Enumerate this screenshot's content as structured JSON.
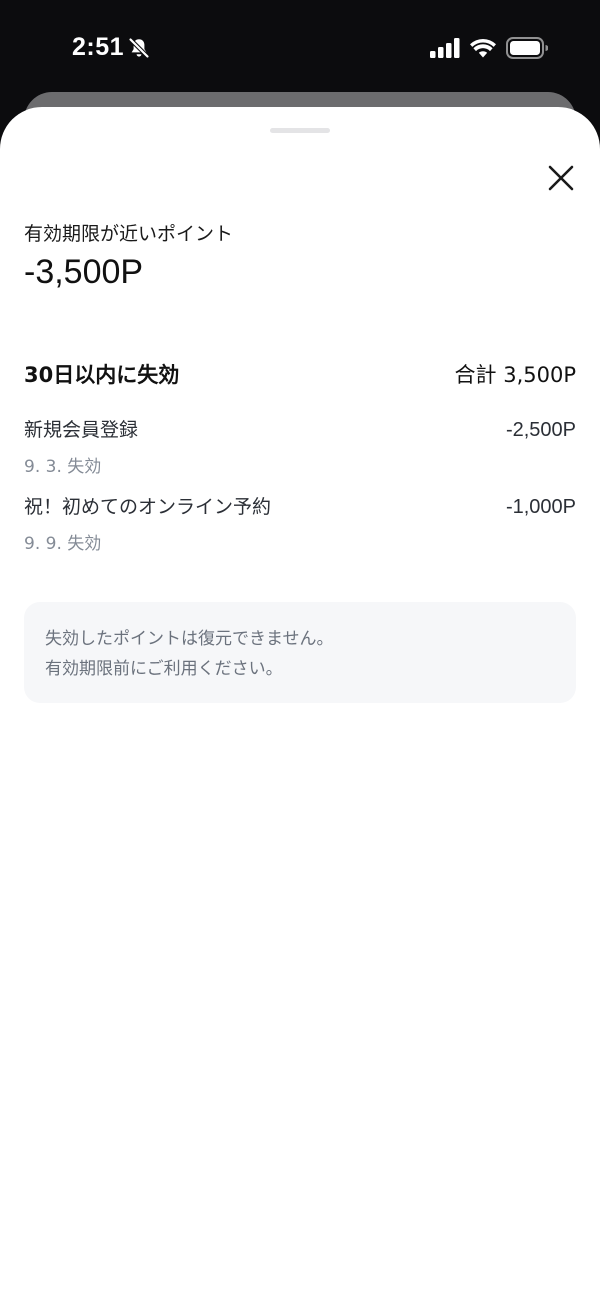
{
  "status_bar": {
    "time": "2:51"
  },
  "sheet": {
    "subtitle": "有効期限が近いポイント",
    "amount": "-3,500P",
    "section": {
      "title": "30日以内に失効",
      "total": "合計 3,500P"
    },
    "items": [
      {
        "name": "新規会員登録",
        "value": "-2,500P",
        "date": "9. 3. 失効"
      },
      {
        "name": "祝！初めてのオンライン予約",
        "value": "-1,000P",
        "date": "9. 9. 失効"
      }
    ],
    "notice": {
      "line1": "失効したポイントは復元できません。",
      "line2": "有効期限前にご利用ください。"
    }
  },
  "icons": {
    "bell": "bell-slash-icon",
    "signal": "cellular-signal-icon",
    "wifi": "wifi-icon",
    "battery": "battery-icon",
    "close": "close-icon"
  },
  "colors": {
    "background": "#0c0c0e",
    "sheet": "#ffffff",
    "notice_bg": "#f6f7f9",
    "muted_text": "#848b96"
  }
}
